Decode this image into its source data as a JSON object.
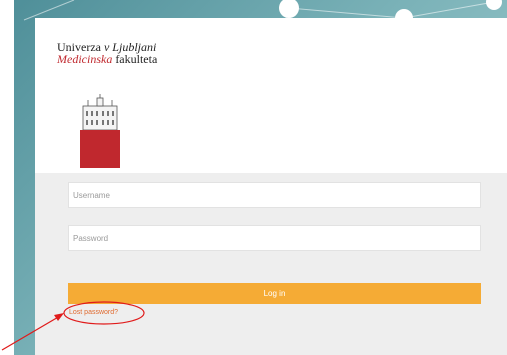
{
  "logo": {
    "line1_a": "Univerza ",
    "line1_b": "v Ljubljani",
    "line2_a": "Medicinska",
    "line2_b": " fakulteta"
  },
  "form": {
    "username_placeholder": "Username",
    "password_placeholder": "Password",
    "login_label": "Log in",
    "lost_password_label": "Lost password?"
  },
  "colors": {
    "accent_button": "#f5ab35",
    "link": "#e06b30",
    "crest_red": "#c0282e",
    "annotation": "#e01b1b",
    "background_teal": "#79b1b7"
  },
  "icons": [
    "university-crest-icon",
    "annotation-arrow-icon"
  ]
}
